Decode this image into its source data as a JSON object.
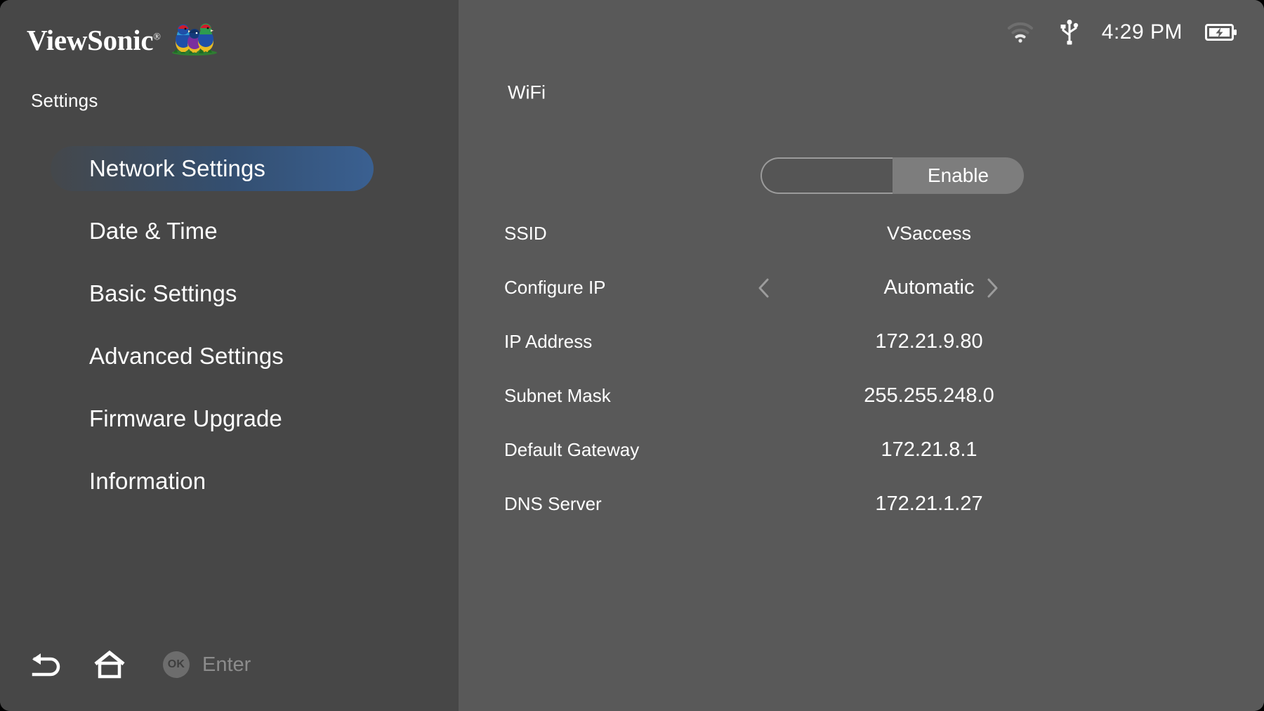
{
  "brand": {
    "name": "ViewSonic",
    "registered_mark": "®",
    "logo_icon": "viewsonic-finches-logo"
  },
  "sidebar": {
    "title": "Settings",
    "items": [
      {
        "label": "Network Settings",
        "active": true
      },
      {
        "label": "Date & Time",
        "active": false
      },
      {
        "label": "Basic Settings",
        "active": false
      },
      {
        "label": "Advanced Settings",
        "active": false
      },
      {
        "label": "Firmware Upgrade",
        "active": false
      },
      {
        "label": "Information",
        "active": false
      }
    ],
    "highlight_color": "#3a6091",
    "background_color": "#474747"
  },
  "bottombar": {
    "back_icon": "back-arrow-icon",
    "home_icon": "home-icon",
    "ok_badge": "OK",
    "enter_label": "Enter"
  },
  "statusbar": {
    "wifi_icon": "wifi-icon",
    "usb_icon": "usb-icon",
    "time": "4:29 PM",
    "battery_icon": "battery-charging-icon"
  },
  "panel": {
    "background_color": "#595959",
    "heading": "WiFi",
    "toggle": {
      "on_label": "Enable",
      "state": "off"
    },
    "rows": [
      {
        "label": "SSID",
        "value": "VSaccess",
        "stepper": false
      },
      {
        "label": "Configure IP",
        "value": "Automatic",
        "stepper": true
      },
      {
        "label": "IP Address",
        "value": "172.21.9.80",
        "stepper": false
      },
      {
        "label": "Subnet Mask",
        "value": "255.255.248.0",
        "stepper": false
      },
      {
        "label": "Default Gateway",
        "value": "172.21.8.1",
        "stepper": false
      },
      {
        "label": "DNS Server",
        "value": "172.21.1.27",
        "stepper": false
      }
    ]
  }
}
